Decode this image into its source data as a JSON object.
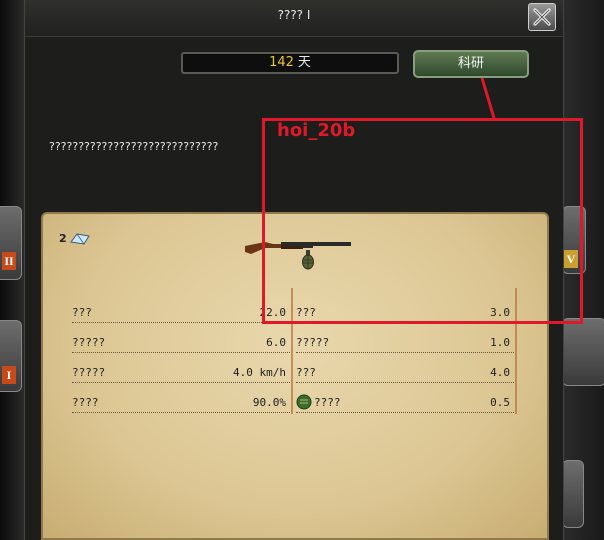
{
  "dialog": {
    "title": "???? I",
    "days_value": "142",
    "days_unit": "天",
    "research_label": "科研",
    "description": "?????????????????????????????"
  },
  "panel": {
    "count": "2",
    "stats_left": [
      {
        "label": "???",
        "value": "22.0"
      },
      {
        "label": "?????",
        "value": "6.0"
      },
      {
        "label": "?????",
        "value": "4.0 km/h"
      },
      {
        "label": "????",
        "value": "90.0%"
      }
    ],
    "stats_right": [
      {
        "label": "???",
        "value": "3.0"
      },
      {
        "label": "?????",
        "value": "1.0"
      },
      {
        "label": "???",
        "value": "4.0"
      },
      {
        "label": "????",
        "value": "0.5"
      }
    ]
  },
  "annotation": {
    "label": "hoi_20b",
    "color": "#e0192a"
  },
  "background": {
    "left_badges": [
      "II",
      "I"
    ],
    "right_badges": [
      "V"
    ]
  },
  "colors": {
    "days_accent": "#f0c330",
    "research_button": "#4a6640",
    "parchment": "#e2cf9f"
  },
  "icons": [
    "close-icon",
    "rifle-icon",
    "grenade-icon",
    "supply-icon"
  ]
}
